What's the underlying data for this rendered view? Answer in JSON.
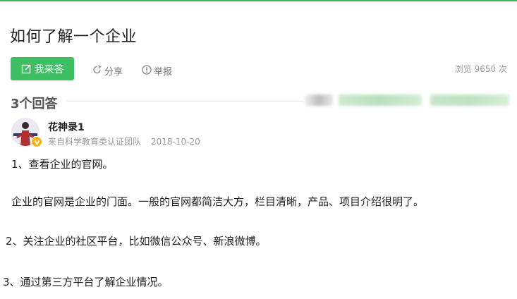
{
  "question": {
    "title": "如何了解一个企业",
    "answer_button_label": "我来答",
    "share_label": "分享",
    "report_label": "举报",
    "views_label": "浏览",
    "views_count": "9650 次"
  },
  "answers_header": {
    "count_label": "3个回答"
  },
  "answer": {
    "author_name": "花神录1",
    "author_source": "来自科学教育类认证团队",
    "date": "2018-10-20",
    "paragraphs": [
      "1、查看企业的官网。",
      "企业的官网是企业的门面。一般的官网都简洁大方，栏目清晰，产品、项目介绍很明了。",
      "2、关注企业的社区平台，比如微信公众号、新浪微博。",
      "3、通过第三方平台了解企业情况。"
    ]
  },
  "colors": {
    "accent_green": "#3fbf63",
    "top_rule": "#3fb15c",
    "muted_text": "#999999",
    "badge_gold": "#f3b51a"
  },
  "icons": {
    "answer_button": "edit-icon",
    "share": "share-icon",
    "report": "report-icon",
    "badge": "verified-badge-icon"
  }
}
